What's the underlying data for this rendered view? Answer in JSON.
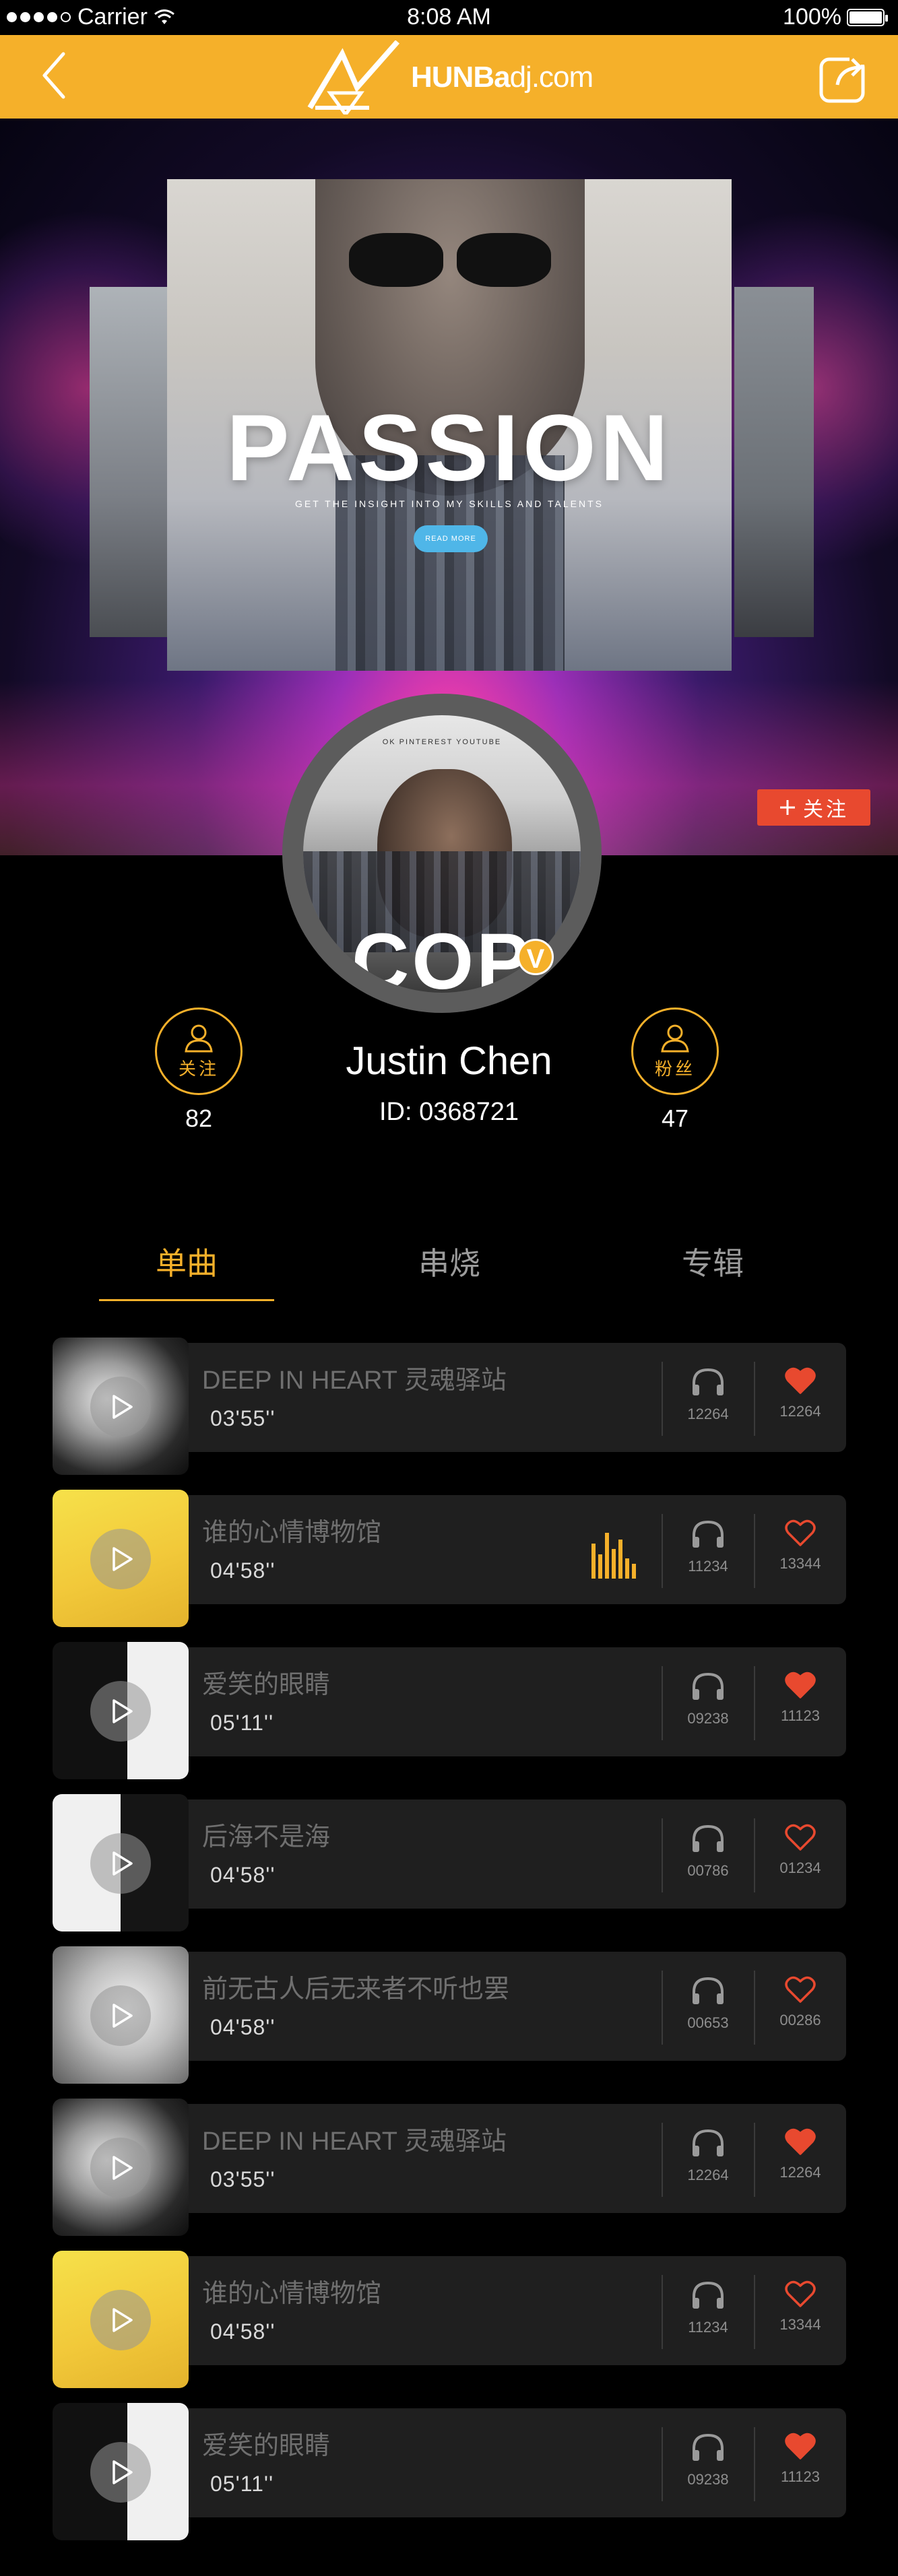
{
  "status_bar": {
    "carrier": "Carrier",
    "time": "8:08 AM",
    "battery": "100%"
  },
  "nav": {
    "logo_bold": "HUNBa",
    "logo_suffix": "dj.com"
  },
  "hero": {
    "cover_title": "PASSION",
    "cover_tagline": "GET THE INSIGHT INTO MY SKILLS AND TALENTS",
    "cover_button": "READ MORE"
  },
  "follow_button": "关注",
  "profile": {
    "avatar_menu": "OK    PINTEREST    YOUTUBE",
    "avatar_text": "COP",
    "verified_badge": "V",
    "name": "Justin Chen",
    "id": "ID: 0368721",
    "following_label": "关注",
    "following_count": "82",
    "fans_label": "粉丝",
    "fans_count": "47"
  },
  "tabs": [
    "单曲",
    "串烧",
    "专辑"
  ],
  "active_tab": 0,
  "tracks": [
    {
      "title": "DEEP IN HEART 灵魂驿站",
      "duration": "03'55''",
      "listens": "12264",
      "likes": "12264",
      "liked": true,
      "playing": false,
      "art": "bw-portrait"
    },
    {
      "title": "谁的心情博物馆",
      "duration": "04'58''",
      "listens": "11234",
      "likes": "13344",
      "liked": false,
      "playing": true,
      "art": "yellow-album"
    },
    {
      "title": "爱笑的眼睛",
      "duration": "05'11''",
      "listens": "09238",
      "likes": "11123",
      "liked": true,
      "playing": false,
      "art": "green-day"
    },
    {
      "title": "后海不是海",
      "duration": "04'58''",
      "listens": "00786",
      "likes": "01234",
      "liked": false,
      "playing": false,
      "art": "bw-faces"
    },
    {
      "title": "前无古人后无来者不听也罢",
      "duration": "04'58''",
      "listens": "00653",
      "likes": "00286",
      "liked": false,
      "playing": false,
      "art": "bw-glasses"
    },
    {
      "title": "DEEP IN HEART 灵魂驿站",
      "duration": "03'55''",
      "listens": "12264",
      "likes": "12264",
      "liked": true,
      "playing": false,
      "art": "bw-portrait"
    },
    {
      "title": "谁的心情博物馆",
      "duration": "04'58''",
      "listens": "11234",
      "likes": "13344",
      "liked": false,
      "playing": false,
      "art": "yellow-album"
    },
    {
      "title": "爱笑的眼睛",
      "duration": "05'11''",
      "listens": "09238",
      "likes": "11123",
      "liked": true,
      "playing": false,
      "art": "green-day"
    }
  ],
  "colors": {
    "accent": "#f5b02a",
    "like": "#e8492f",
    "row_bg": "#1f1f1f"
  },
  "icons": {
    "back": "chevron-left-icon",
    "share": "share-icon",
    "listen": "headphones-icon",
    "like": "heart-icon",
    "play": "play-icon",
    "equalizer": "equalizer-icon"
  }
}
